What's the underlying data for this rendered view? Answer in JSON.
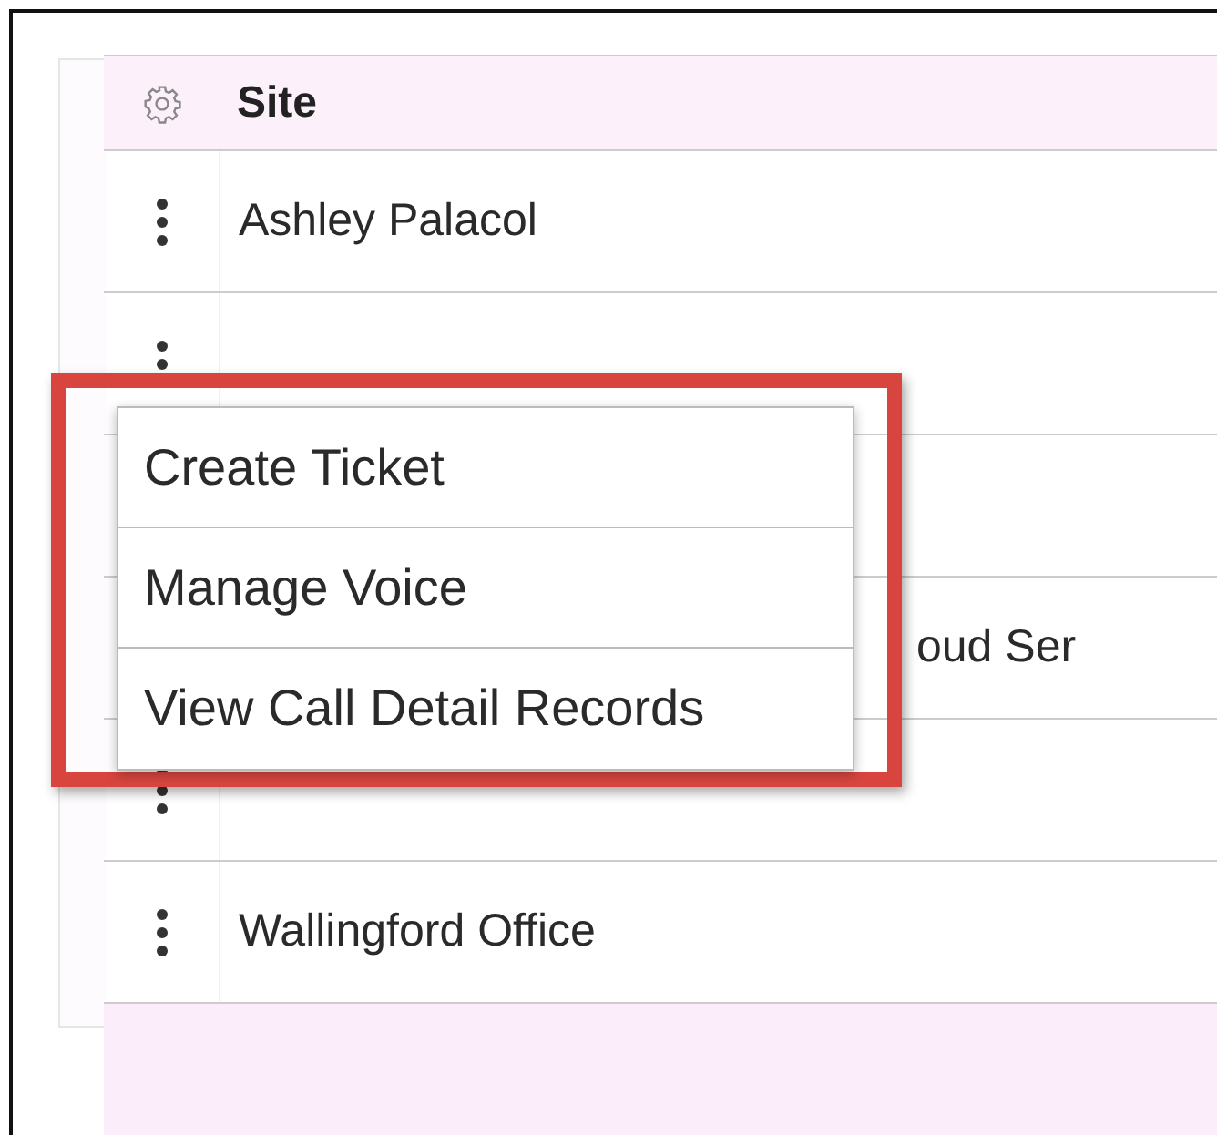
{
  "table": {
    "header": {
      "label": "Site"
    },
    "rows": [
      {
        "site": "Ashley Palacol",
        "menu_icon": true
      },
      {
        "menu_icon": true
      },
      {},
      {
        "site": "oud Ser"
      },
      {
        "menu_icon": true
      },
      {
        "site": "Wallingford Office",
        "menu_icon": true
      }
    ]
  },
  "context_menu": {
    "items": [
      {
        "label": "Create Ticket"
      },
      {
        "label": "Manage Voice"
      },
      {
        "label": "View Call Detail Records"
      }
    ]
  }
}
